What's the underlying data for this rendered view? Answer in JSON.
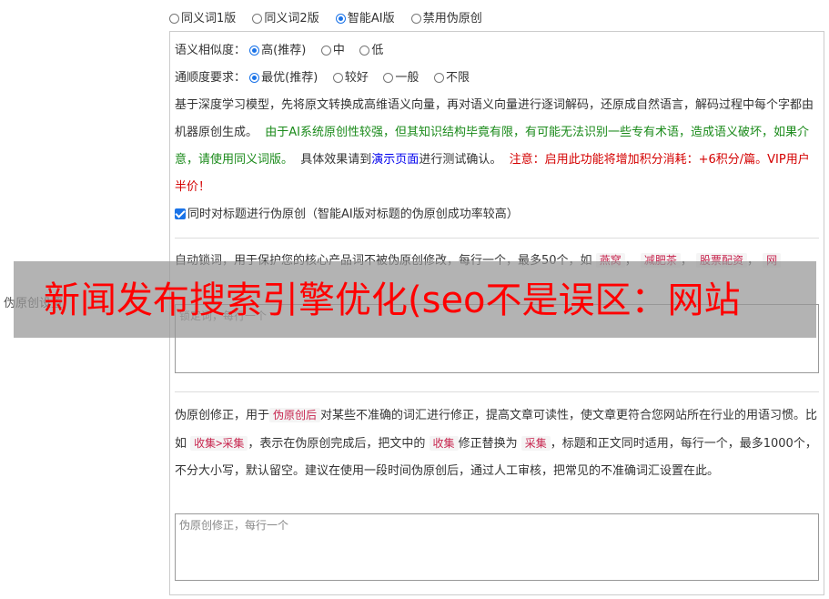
{
  "modes": [
    {
      "label": "同义词1版",
      "checked": false
    },
    {
      "label": "同义词2版",
      "checked": false
    },
    {
      "label": "智能AI版",
      "checked": true
    },
    {
      "label": "禁用伪原创",
      "checked": false
    }
  ],
  "similarity": {
    "label": "语义相似度：",
    "options": [
      "高(推荐)",
      "中",
      "低"
    ]
  },
  "fluency": {
    "label": "通顺度要求：",
    "options": [
      "最优(推荐)",
      "较好",
      "一般",
      "不限"
    ]
  },
  "description": {
    "part1": "基于深度学习模型，先将原文转换成高维语义向量，再对语义向量进行逐词解码，还原成自然语言，解码过程中每个字都由机器原创生成。",
    "warning_green": "由于AI系统原创性较强，但其知识结构毕竟有限，有可能无法识别一些专有术语，造成语义破坏，如果介意，请使用同义词版。",
    "part2": "具体效果请到",
    "demo_link": "演示页面",
    "part3": "进行测试确认。",
    "warning_red": "注意：启用此功能将增加积分消耗：+6积分/篇。VIP用户半价！"
  },
  "title_option": {
    "label": "同时对标题进行伪原创（智能AI版对标题的伪原创成功率较高）",
    "checked": true
  },
  "lock_words": {
    "text_prefix": "自动锁词，用于保护您的核心产品词不被伪原创修改，每行一个，最多50个，如",
    "examples": [
      "燕窝",
      "减肥茶",
      "股票配资",
      "网"
    ],
    "side_label": "伪原创设置",
    "placeholder": "锁定词，每行一个"
  },
  "correction": {
    "intro": "伪原创修正，用于",
    "code1": "伪原创后",
    "text1": "对某些不准确的词汇进行修正，提高文章可读性，使文章更符合您网站所在行业的用语习惯。比如",
    "code2": "收集>采集",
    "text2": "，表示在伪原创完成后，把文中的",
    "code3": "收集",
    "text3": "修正替换为",
    "code4": "采集",
    "text4": "，标题和正文同时适用，每行一个，最多1000个，不分大小写，默认留空。建议在使用一段时间伪原创后，通过人工审核，把常见的不准确词汇设置在此。",
    "placeholder": "伪原创修正，每行一个"
  },
  "overlay_text": "新闻发布搜索引擎优化(seo不是误区：网站"
}
